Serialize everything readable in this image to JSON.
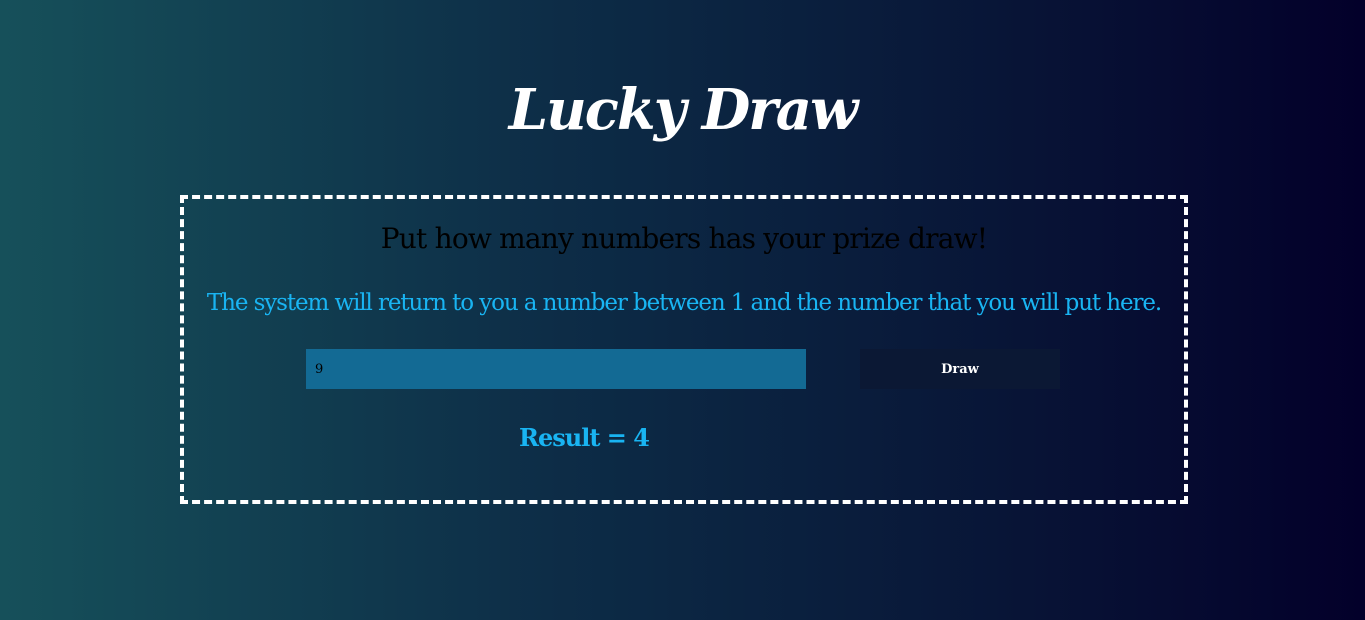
{
  "header": {
    "title": "Lucky Draw"
  },
  "panel": {
    "heading": "Put how many numbers has your prize draw!",
    "subtitle": "The system will return to you a number between 1 and the number that you will put here.",
    "input": {
      "value": "9"
    },
    "draw_button_label": "Draw",
    "result_text": "Result = 4"
  },
  "colors": {
    "accent": "#19b4f2",
    "input_background": "#136a94",
    "button_background": "#0b1834",
    "border": "#ffffff"
  }
}
